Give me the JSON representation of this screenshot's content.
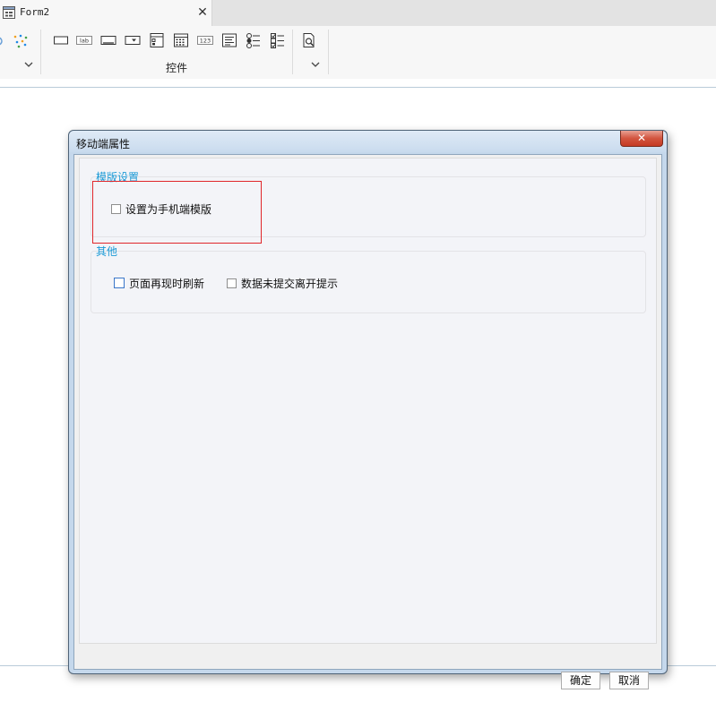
{
  "tab": {
    "title": "Form2",
    "close_glyph": "✕"
  },
  "ribbon": {
    "group_label": "控件",
    "widgets": [
      {
        "icon": "rect-icon"
      },
      {
        "icon": "label-icon",
        "text": "lab"
      },
      {
        "icon": "textbox-icon"
      },
      {
        "icon": "dropdown-icon"
      },
      {
        "icon": "form-icon"
      },
      {
        "icon": "calendar-icon"
      },
      {
        "icon": "number-icon",
        "text": "123"
      },
      {
        "icon": "textarea-icon"
      },
      {
        "icon": "radio-list-icon"
      },
      {
        "icon": "checkbox-list-icon"
      },
      {
        "icon": "preview-icon"
      }
    ]
  },
  "dialog": {
    "title": "移动端属性",
    "close_glyph": "✕",
    "sections": {
      "template": {
        "legend": "模版设置",
        "checkbox_label": "设置为手机端模版",
        "checked": false
      },
      "other": {
        "legend": "其他",
        "checkbox1_label": "页面再现时刷新",
        "checkbox1_checked": false,
        "checkbox2_label": "数据未提交离开提示",
        "checkbox2_checked": false
      }
    },
    "ok_label": "确定",
    "cancel_label": "取消"
  }
}
